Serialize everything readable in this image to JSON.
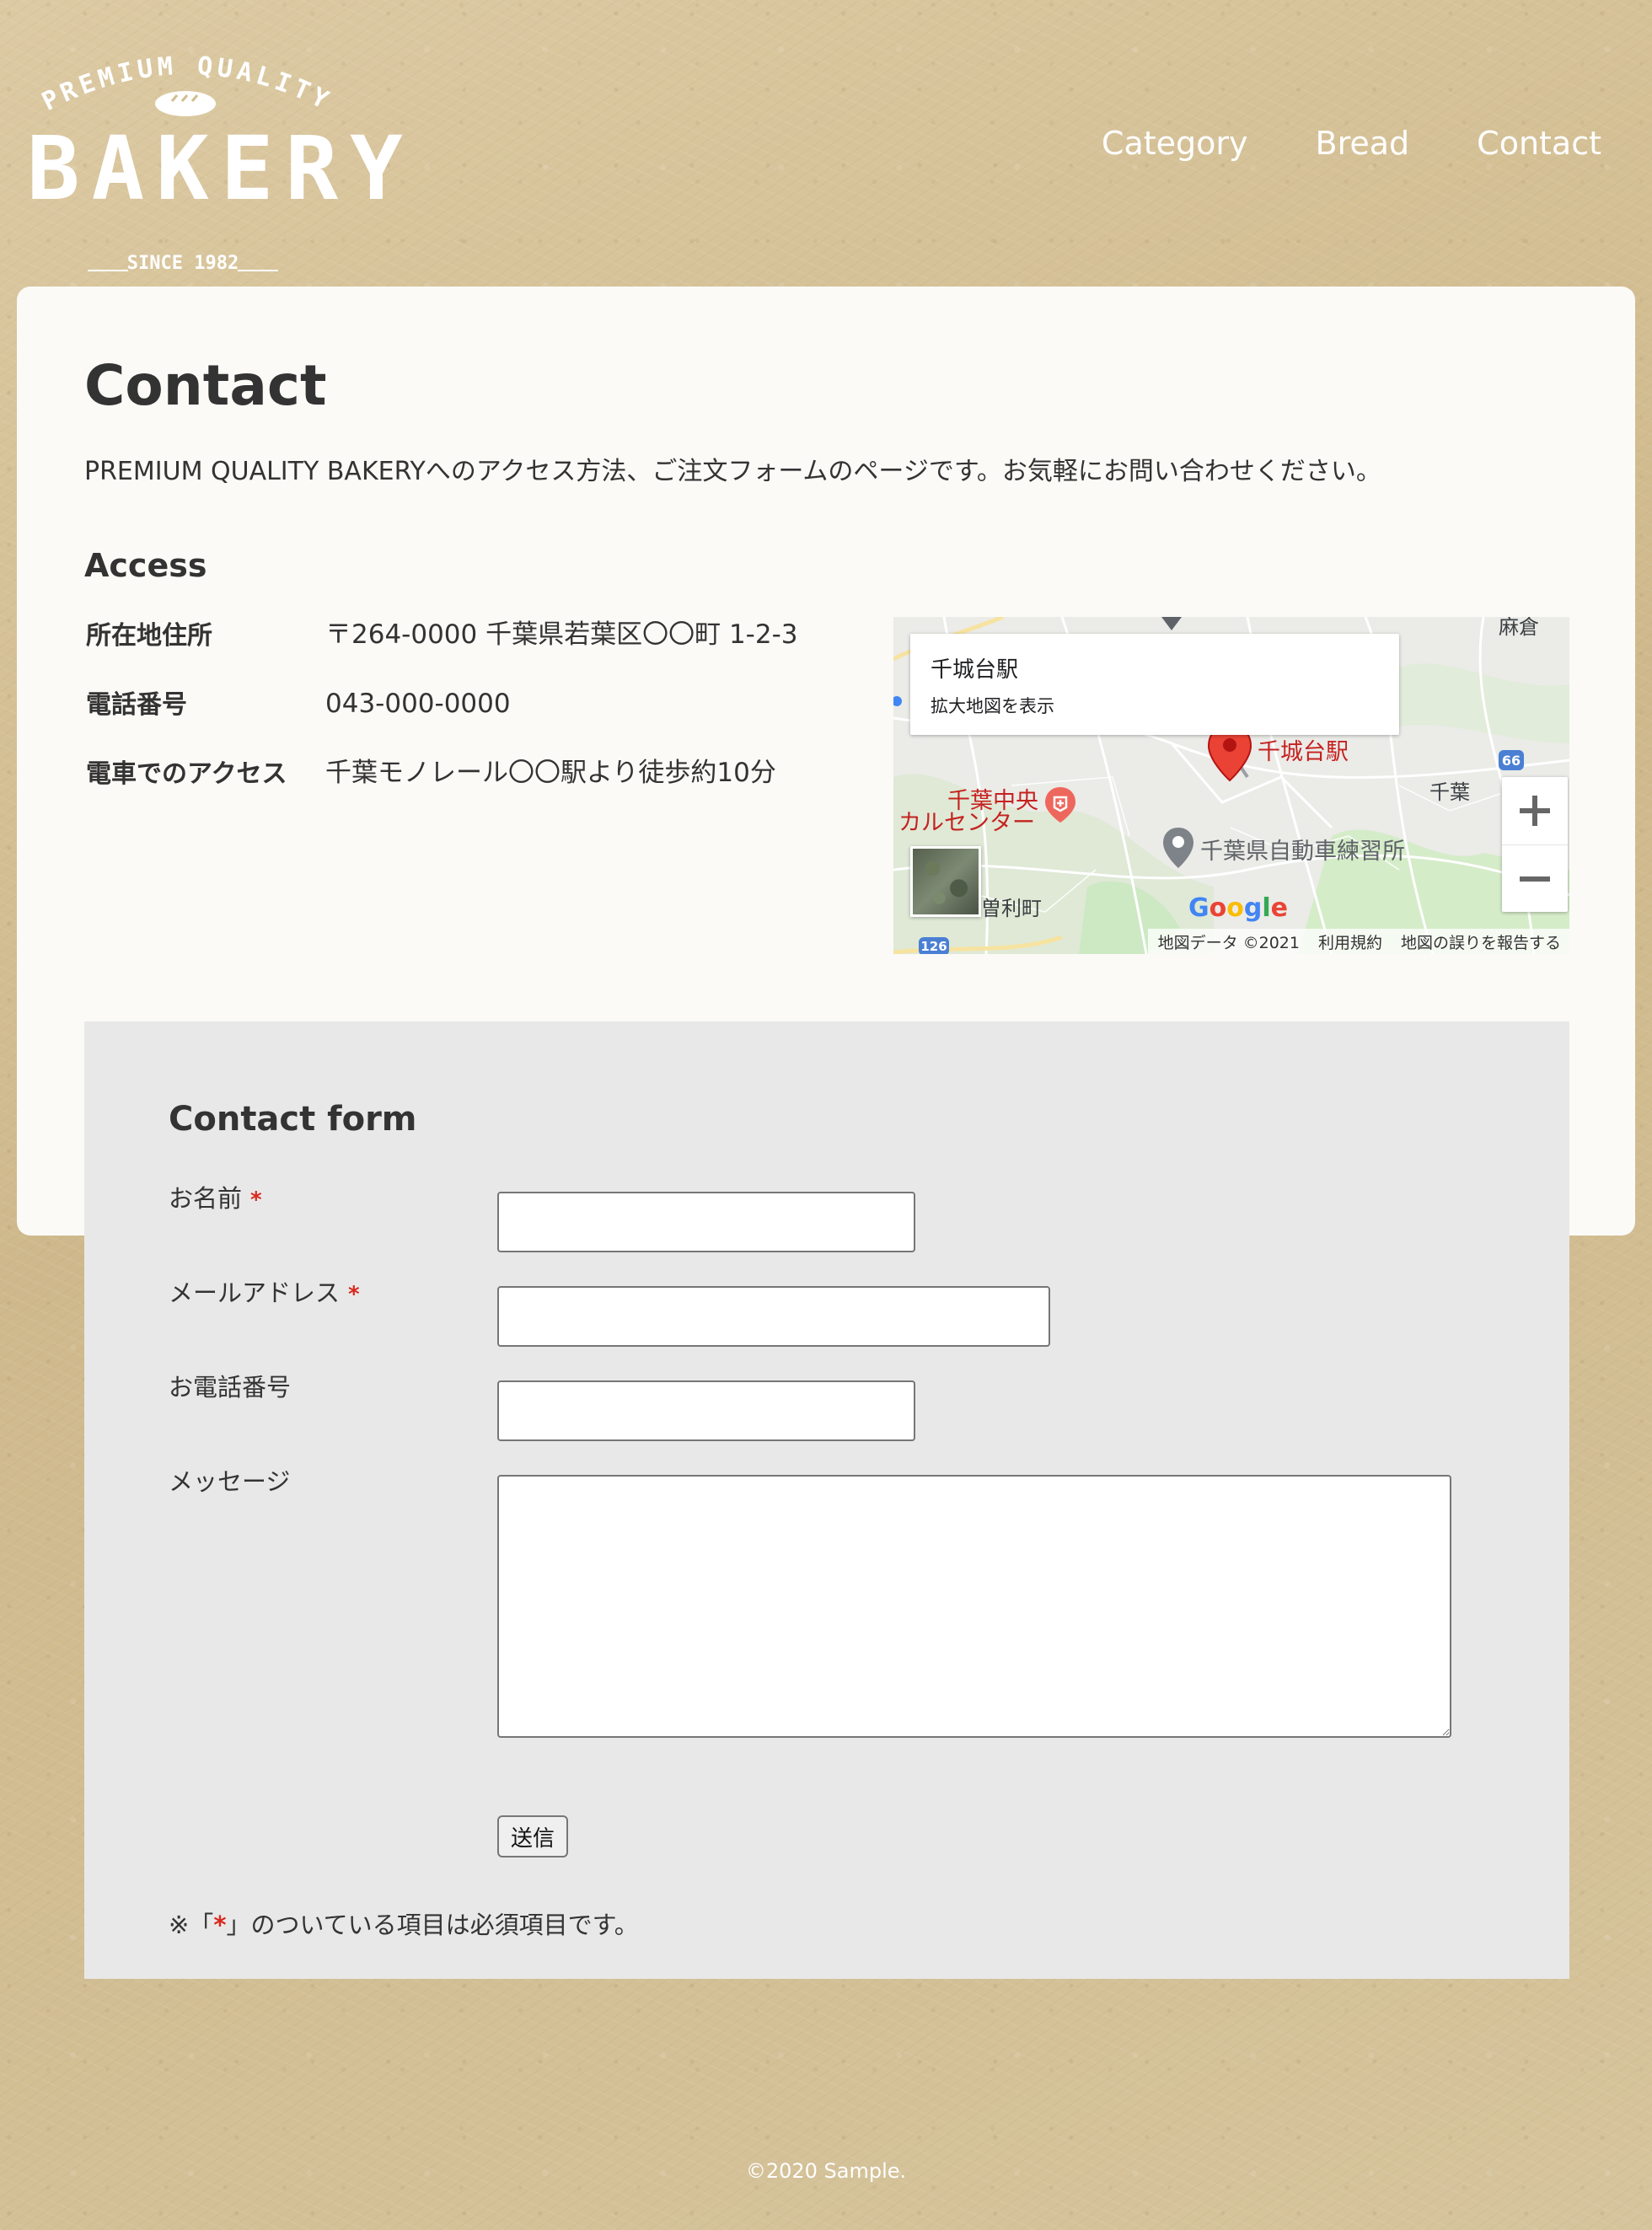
{
  "logo": {
    "arc_text": "PREMIUM QUALITY",
    "word": "BAKERY",
    "since": "SINCE 1982"
  },
  "nav": [
    {
      "label": "Category"
    },
    {
      "label": "Bread"
    },
    {
      "label": "Contact"
    }
  ],
  "page": {
    "title": "Contact",
    "intro": "PREMIUM QUALITY BAKERYへのアクセス方法、ご注文フォームのページです。お気軽にお問い合わせください。"
  },
  "access": {
    "title": "Access",
    "rows": [
      {
        "label": "所在地住所",
        "value": "〒264-0000 千葉県若葉区〇〇町 1-2-3"
      },
      {
        "label": "電話番号",
        "value": "043-000-0000"
      },
      {
        "label": "電車でのアクセス",
        "value": "千葉モノレール〇〇駅より徒歩約10分"
      }
    ]
  },
  "map": {
    "info_title": "千城台駅",
    "info_link": "拡大地図を表示",
    "labels": {
      "station": "千城台駅",
      "hospital_1": "千葉中央",
      "hospital_2": "カルセンター",
      "driving_school": "千葉県自動車練習所",
      "town": "曽利町",
      "area_right": "千葉",
      "area_top": "麻倉"
    },
    "road_numbers": {
      "r1": "66",
      "r2": "126"
    },
    "google": [
      "G",
      "o",
      "o",
      "g",
      "l",
      "e"
    ],
    "footer": {
      "data": "地図データ ©2021",
      "terms": "利用規約",
      "report": "地図の誤りを報告する"
    },
    "colors": {
      "pin": "#ea4335",
      "water": "#aadaff",
      "park": "#cde9c4",
      "road": "#ffffff",
      "label_red": "#c5221f"
    }
  },
  "form": {
    "title": "Contact form",
    "fields": [
      {
        "label": "お名前",
        "required": true,
        "value": ""
      },
      {
        "label": "メールアドレス",
        "required": true,
        "value": ""
      },
      {
        "label": "お電話番号",
        "required": false,
        "value": ""
      },
      {
        "label": "メッセージ",
        "required": false,
        "value": ""
      }
    ],
    "required_mark": "*",
    "submit_label": "送信",
    "note_prefix": "※「",
    "note_star": "*",
    "note_suffix": "」のついている項目は必須項目です。"
  },
  "footer": {
    "copyright": "©2020 Sample."
  }
}
